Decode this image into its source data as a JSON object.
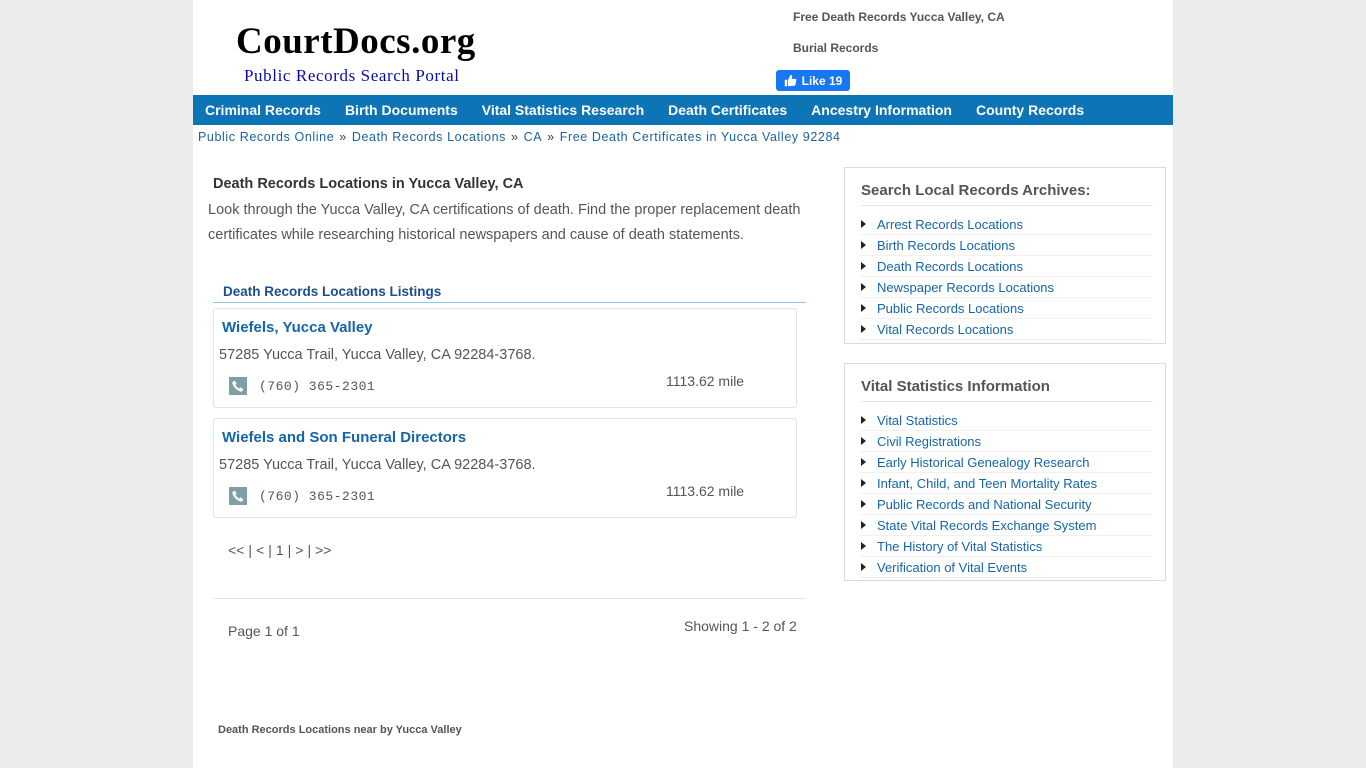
{
  "header": {
    "logo_title": "CourtDocs.org",
    "logo_subtitle": "Public Records Search Portal",
    "links": [
      "Free Death Records Yucca Valley, CA",
      "Burial Records"
    ],
    "fb_like": "Like 19"
  },
  "nav": [
    "Criminal Records",
    "Birth Documents",
    "Vital Statistics Research",
    "Death Certificates",
    "Ancestry Information",
    "County Records"
  ],
  "breadcrumb": [
    "Public Records Online",
    "Death Records Locations",
    "CA",
    "Free Death Certificates in Yucca Valley 92284"
  ],
  "breadcrumb_separator": "»",
  "main": {
    "title": "Death Records Locations in Yucca Valley, CA",
    "intro": "Look through the Yucca Valley, CA certifications of death. Find the proper replacement death certificates while researching historical newspapers and cause of death statements.",
    "listings_heading": "Death Records Locations Listings",
    "listings": [
      {
        "name": "Wiefels, Yucca Valley",
        "address": "57285 Yucca Trail, Yucca Valley, CA 92284-3768.",
        "phone": "(760) 365-2301",
        "distance": "1113.62 mile"
      },
      {
        "name": "Wiefels and Son Funeral Directors",
        "address": "57285 Yucca Trail, Yucca Valley, CA 92284-3768.",
        "phone": "(760) 365-2301",
        "distance": "1113.62 mile"
      }
    ],
    "pager": {
      "first": "<<",
      "prev": "<",
      "current": "1",
      "next": ">",
      "last": ">>",
      "separator": "|"
    },
    "page_of": "Page 1 of 1",
    "showing": "Showing 1 - 2 of 2",
    "nearby": "Death Records Locations near by Yucca Valley"
  },
  "sidebar": {
    "archives": {
      "title": "Search Local Records Archives:",
      "items": [
        "Arrest Records Locations",
        "Birth Records Locations",
        "Death Records Locations",
        "Newspaper Records Locations",
        "Public Records Locations",
        "Vital Records Locations"
      ]
    },
    "vital": {
      "title": "Vital Statistics Information",
      "items": [
        "Vital Statistics",
        "Civil Registrations",
        "Early Historical Genealogy Research",
        "Infant, Child, and Teen Mortality Rates",
        "Public Records and National Security",
        "State Vital Records Exchange System",
        "The History of Vital Statistics",
        "Verification of Vital Events"
      ]
    }
  },
  "colors": {
    "nav_bg": "#0d74b5",
    "link": "#1565a8",
    "facebook": "#1877f2",
    "logo_sub": "#0a0aa8"
  }
}
